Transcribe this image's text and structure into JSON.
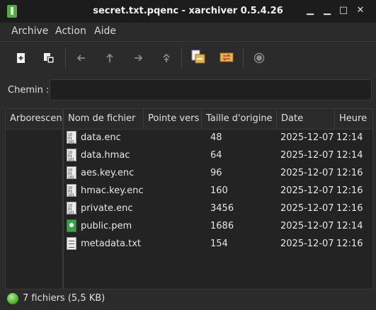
{
  "window": {
    "title": "secret.txt.pqenc - xarchiver 0.5.4.26",
    "controls": [
      "minimize-icon",
      "maximize-icon",
      "close-icon"
    ]
  },
  "menubar": {
    "items": [
      "Archive",
      "Action",
      "Aide"
    ]
  },
  "toolbar": {
    "buttons": [
      "new-archive-icon",
      "open-archive-icon",
      "back-icon",
      "up-icon",
      "forward-icon",
      "home-icon",
      "extract-icon",
      "convert-icon",
      "stop-icon"
    ]
  },
  "pathbar": {
    "label": "Chemin :",
    "value": ""
  },
  "tree": {
    "header": "Arborescence"
  },
  "table": {
    "columns": [
      "Nom de fichier",
      "Pointe vers",
      "Taille d'origine",
      "Date",
      "Heure"
    ],
    "rows": [
      {
        "icon": "binary-file-icon",
        "name": "data.enc",
        "target": "",
        "size": "48",
        "date": "2025-12-07",
        "time": "12:14"
      },
      {
        "icon": "binary-file-icon",
        "name": "data.hmac",
        "target": "",
        "size": "64",
        "date": "2025-12-07",
        "time": "12:14"
      },
      {
        "icon": "binary-file-icon",
        "name": "aes.key.enc",
        "target": "",
        "size": "96",
        "date": "2025-12-07",
        "time": "12:16"
      },
      {
        "icon": "binary-file-icon",
        "name": "hmac.key.enc",
        "target": "",
        "size": "160",
        "date": "2025-12-07",
        "time": "12:16"
      },
      {
        "icon": "binary-file-icon",
        "name": "private.enc",
        "target": "",
        "size": "3456",
        "date": "2025-12-07",
        "time": "12:16"
      },
      {
        "icon": "certificate-file-icon",
        "name": "public.pem",
        "target": "",
        "size": "1686",
        "date": "2025-12-07",
        "time": "12:14"
      },
      {
        "icon": "text-file-icon",
        "name": "metadata.txt",
        "target": "",
        "size": "154",
        "date": "2025-12-07",
        "time": "12:16"
      }
    ]
  },
  "statusbar": {
    "text": "7 fichiers  (5,5 KB)",
    "indicator_color": "#47b82a"
  }
}
